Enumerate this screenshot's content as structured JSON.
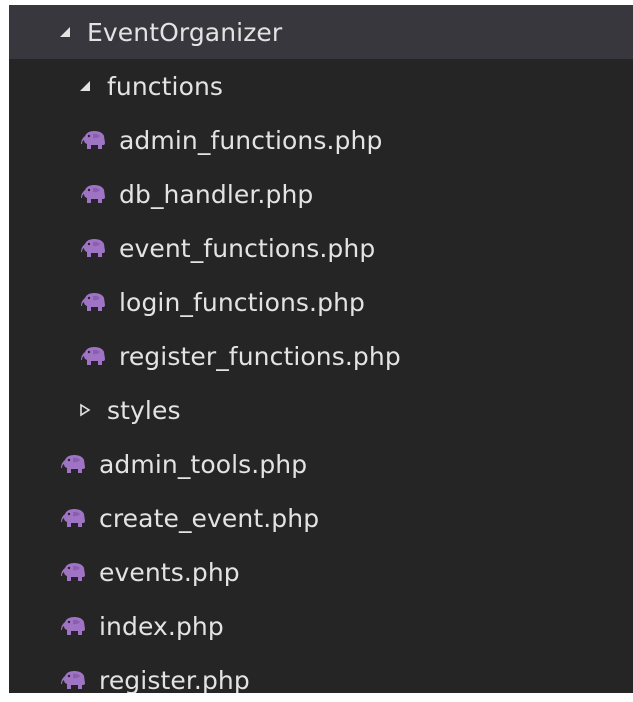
{
  "explorer": {
    "root": {
      "label": "EventOrganizer",
      "expanded": true,
      "icon": "expanded-triangle-icon"
    },
    "functions_folder": {
      "label": "functions",
      "expanded": true,
      "icon": "expanded-triangle-icon",
      "files": [
        {
          "label": "admin_functions.php",
          "icon": "php-elephant-icon"
        },
        {
          "label": "db_handler.php",
          "icon": "php-elephant-icon"
        },
        {
          "label": "event_functions.php",
          "icon": "php-elephant-icon"
        },
        {
          "label": "login_functions.php",
          "icon": "php-elephant-icon"
        },
        {
          "label": "register_functions.php",
          "icon": "php-elephant-icon"
        }
      ]
    },
    "styles_folder": {
      "label": "styles",
      "expanded": false,
      "icon": "collapsed-triangle-icon"
    },
    "root_files": [
      {
        "label": "admin_tools.php",
        "icon": "php-elephant-icon"
      },
      {
        "label": "create_event.php",
        "icon": "php-elephant-icon"
      },
      {
        "label": "events.php",
        "icon": "php-elephant-icon"
      },
      {
        "label": "index.php",
        "icon": "php-elephant-icon"
      },
      {
        "label": "register.php",
        "icon": "php-elephant-icon"
      }
    ]
  },
  "colors": {
    "background": "#252526",
    "selected_row": "#37373d",
    "text": "#e3e3e3",
    "php_icon": "#a074c4"
  }
}
